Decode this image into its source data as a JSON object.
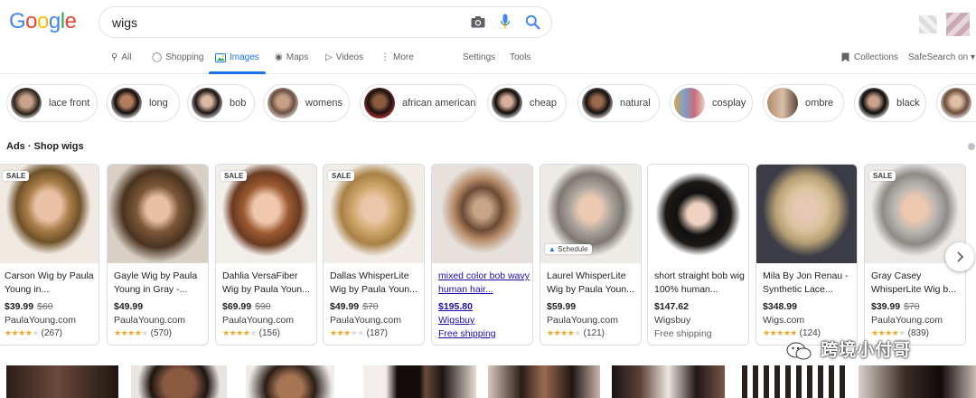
{
  "header": {
    "logo": "Google",
    "search_value": "wigs",
    "icons": [
      "camera-icon",
      "mic-icon",
      "search-icon"
    ]
  },
  "tabs": [
    {
      "label": "All",
      "icon": "search-icon"
    },
    {
      "label": "Shopping",
      "icon": "tag-icon"
    },
    {
      "label": "Images",
      "icon": "image-icon"
    },
    {
      "label": "Maps",
      "icon": "pin-icon"
    },
    {
      "label": "Videos",
      "icon": "play-icon"
    },
    {
      "label": "More",
      "icon": "more-vertical-icon"
    }
  ],
  "tools": {
    "settings": "Settings",
    "tools": "Tools",
    "collections": "Collections",
    "safesearch": "SafeSearch on"
  },
  "chips": [
    "lace front",
    "long",
    "bob",
    "womens",
    "african american",
    "cheap",
    "natural",
    "cosplay",
    "ombre",
    "black"
  ],
  "ads_title": "Ads · Shop wigs",
  "cards": [
    {
      "title": "Carson Wig by Paula Young in...",
      "price": "$39.99",
      "old": "$60",
      "store": "PaulaYoung.com",
      "rating": 3.5,
      "count": "(267)",
      "badge": "SALE"
    },
    {
      "title": "Gayle Wig by Paula Young in Gray -...",
      "price": "$49.99",
      "old": "",
      "store": "PaulaYoung.com",
      "rating": 4,
      "count": "(570)",
      "badge": ""
    },
    {
      "title": "Dahlia VersaFiber Wig by Paula Youn...",
      "price": "$69.99",
      "old": "$90",
      "store": "PaulaYoung.com",
      "rating": 4,
      "count": "(156)",
      "badge": "SALE"
    },
    {
      "title": "Dallas WhisperLite Wig by Paula Youn...",
      "price": "$49.99",
      "old": "$70",
      "store": "PaulaYoung.com",
      "rating": 3,
      "count": "(187)",
      "badge": "SALE"
    },
    {
      "title": "mixed color bob wavy human hair...",
      "price": "$195.80",
      "old": "",
      "store": "Wigsbuy",
      "shipping": "Free shipping",
      "badge": ""
    },
    {
      "title": "Laurel WhisperLite Wig by Paula Youn...",
      "price": "$59.99",
      "old": "",
      "store": "PaulaYoung.com",
      "rating": 3.5,
      "count": "(121)",
      "badge": "",
      "schedule": "Schedule"
    },
    {
      "title": "short straight bob wig 100% human...",
      "price": "$147.62",
      "old": "",
      "store": "Wigsbuy",
      "shipping": "Free shipping",
      "badge": ""
    },
    {
      "title": "Mila By Jon Renau - Synthetic Lace...",
      "price": "$348.99",
      "old": "",
      "store": "Wigs.com",
      "rating": 4.5,
      "count": "(124)",
      "badge": ""
    },
    {
      "title": "Gray Casey WhisperLite Wig b...",
      "price": "$39.99",
      "old": "$70",
      "store": "PaulaYoung.com",
      "rating": 4,
      "count": "(839)",
      "badge": "SALE"
    }
  ],
  "watermark": "跨境小付哥",
  "colors": {
    "link": "#1a0dab",
    "accent": "#1a73e8",
    "star": "#f5a623"
  }
}
